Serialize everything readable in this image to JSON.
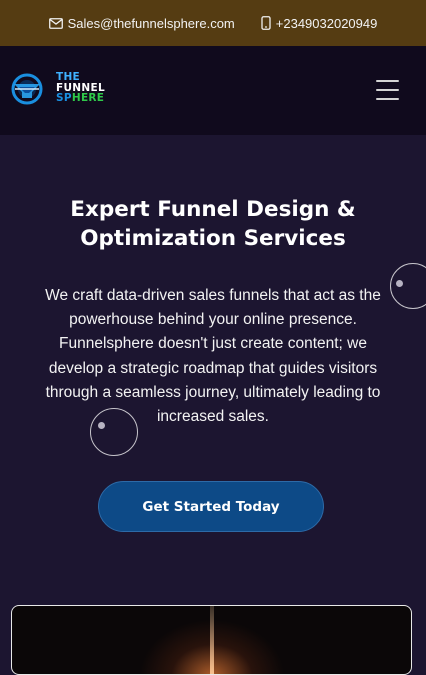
{
  "topbar": {
    "email": "Sales@thefunnelsphere.com",
    "phone": "+2349032020949",
    "email_icon": "envelope-icon",
    "phone_icon": "mobile-phone-icon",
    "background": "#553c12"
  },
  "navbar": {
    "logo": {
      "line1": "THE",
      "line2": "FUNNEL",
      "line3a": "SP",
      "line3b": "HERE"
    },
    "menu_icon": "hamburger-menu-icon",
    "background": "#100a1d"
  },
  "hero": {
    "title": "Expert Funnel Design & Optimization Services",
    "description": "We craft data-driven sales funnels that act as the powerhouse behind your online presence. Funnelsphere doesn't just create content; we develop a strategic roadmap that guides visitors through a seamless journey, ultimately leading to increased sales.",
    "cta_label": "Get Started Today",
    "background": "#1c1530",
    "cta_color": "#0d4a87"
  }
}
